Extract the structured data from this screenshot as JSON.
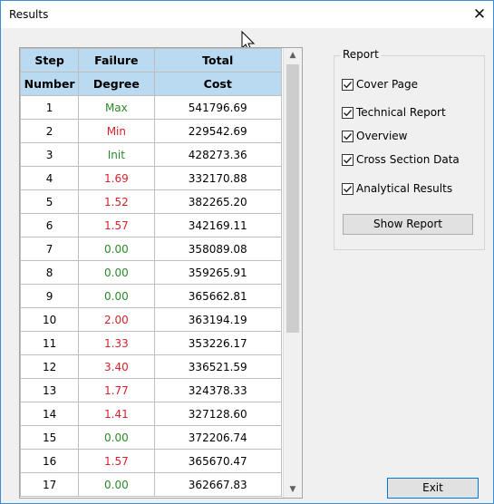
{
  "window": {
    "title": "Results",
    "close_icon": "close-icon"
  },
  "table": {
    "headers": [
      [
        "Step",
        "Failure",
        "Total"
      ],
      [
        "Number",
        "Degree",
        "Cost"
      ]
    ],
    "rows": [
      {
        "step": "1",
        "failure": "Max",
        "cost": "541796.69",
        "status": "green"
      },
      {
        "step": "2",
        "failure": "Min",
        "cost": "229542.69",
        "status": "red"
      },
      {
        "step": "3",
        "failure": "Init",
        "cost": "428273.36",
        "status": "green"
      },
      {
        "step": "4",
        "failure": "1.69",
        "cost": "332170.88",
        "status": "red"
      },
      {
        "step": "5",
        "failure": "1.52",
        "cost": "382265.20",
        "status": "red"
      },
      {
        "step": "6",
        "failure": "1.57",
        "cost": "342169.11",
        "status": "red"
      },
      {
        "step": "7",
        "failure": "0.00",
        "cost": "358089.08",
        "status": "green"
      },
      {
        "step": "8",
        "failure": "0.00",
        "cost": "359265.91",
        "status": "green"
      },
      {
        "step": "9",
        "failure": "0.00",
        "cost": "365662.81",
        "status": "green"
      },
      {
        "step": "10",
        "failure": "2.00",
        "cost": "363194.19",
        "status": "red"
      },
      {
        "step": "11",
        "failure": "1.33",
        "cost": "353226.17",
        "status": "red"
      },
      {
        "step": "12",
        "failure": "3.40",
        "cost": "336521.59",
        "status": "red"
      },
      {
        "step": "13",
        "failure": "1.77",
        "cost": "324378.33",
        "status": "red"
      },
      {
        "step": "14",
        "failure": "1.41",
        "cost": "327128.60",
        "status": "red"
      },
      {
        "step": "15",
        "failure": "0.00",
        "cost": "372206.74",
        "status": "green"
      },
      {
        "step": "16",
        "failure": "1.57",
        "cost": "365670.47",
        "status": "red"
      },
      {
        "step": "17",
        "failure": "0.00",
        "cost": "362667.83",
        "status": "green"
      }
    ]
  },
  "report": {
    "group_label": "Report",
    "options": [
      {
        "label": "Cover Page",
        "checked": true
      },
      {
        "label": "Technical Report",
        "checked": true
      },
      {
        "label": "Overview",
        "checked": true
      },
      {
        "label": "Cross Section Data",
        "checked": true
      },
      {
        "label": "Analytical Results",
        "checked": true
      }
    ],
    "show_button": "Show Report"
  },
  "exit_button": "Exit",
  "colors": {
    "header_bg": "#b9daf0",
    "positive": "#2a8a2a",
    "negative": "#d8212a",
    "accent": "#0078d7"
  }
}
